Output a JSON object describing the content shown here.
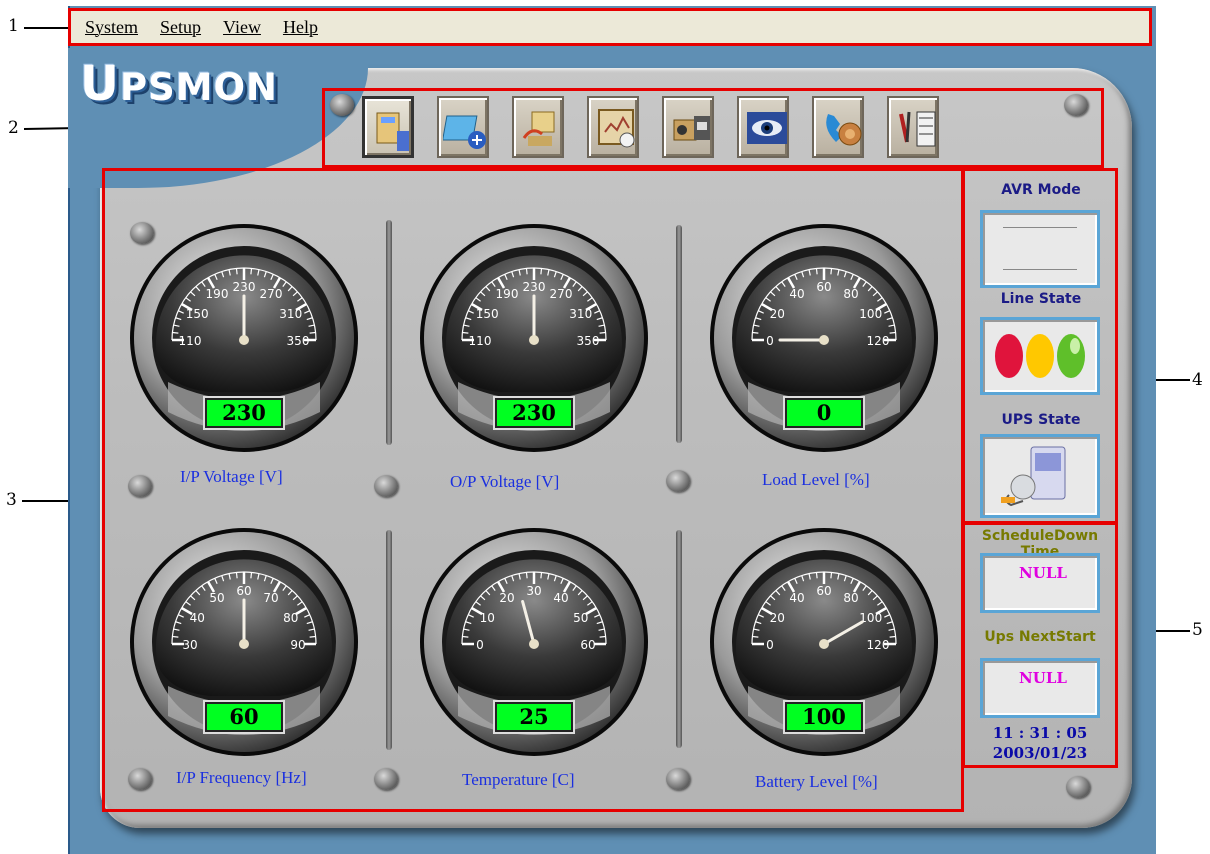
{
  "callouts": [
    "1",
    "2",
    "3",
    "4",
    "5"
  ],
  "menu": [
    "System",
    "Setup",
    "View",
    "Help"
  ],
  "logo": {
    "first": "U",
    "rest": "PSMON"
  },
  "toolbar": {
    "buttons": [
      {
        "name": "settings-tool-icon"
      },
      {
        "name": "add-device-icon"
      },
      {
        "name": "computer-transfer-icon"
      },
      {
        "name": "monitor-chart-icon"
      },
      {
        "name": "recorder-icon"
      },
      {
        "name": "eye-icon"
      },
      {
        "name": "phone-icon"
      },
      {
        "name": "tools-icon"
      }
    ]
  },
  "gauges": [
    {
      "label": "I/P Voltage [V]",
      "value": "230",
      "needle": 230,
      "min": 110,
      "max": 350,
      "ticks": [
        "110",
        "150",
        "190",
        "230",
        "270",
        "310",
        "350"
      ]
    },
    {
      "label": "O/P Voltage [V]",
      "value": "230",
      "needle": 230,
      "min": 110,
      "max": 350,
      "ticks": [
        "110",
        "150",
        "190",
        "230",
        "270",
        "310",
        "350"
      ]
    },
    {
      "label": "Load Level [%]",
      "value": "0",
      "needle": 0,
      "min": 0,
      "max": 120,
      "ticks": [
        "0",
        "20",
        "40",
        "60",
        "80",
        "100",
        "120"
      ]
    },
    {
      "label": "I/P Frequency [Hz]",
      "value": "60",
      "needle": 60,
      "min": 30,
      "max": 90,
      "ticks": [
        "30",
        "40",
        "50",
        "60",
        "70",
        "80",
        "90"
      ]
    },
    {
      "label": "Temperature [C]",
      "value": "25",
      "needle": 25,
      "min": 0,
      "max": 60,
      "ticks": [
        "0",
        "10",
        "20",
        "30",
        "40",
        "50",
        "60"
      ]
    },
    {
      "label": "Battery Level [%]",
      "value": "100",
      "needle": 100,
      "min": 0,
      "max": 120,
      "ticks": [
        "0",
        "20",
        "40",
        "60",
        "80",
        "100",
        "120"
      ]
    }
  ],
  "side": {
    "avr_title": "AVR Mode",
    "line_title": "Line State",
    "ups_title": "UPS State",
    "schedule_title": "ScheduleDown Time",
    "schedule_value": "NULL",
    "next_title": "Ups NextStart",
    "next_value": "NULL",
    "time": "11 : 31 : 05",
    "date": "2003/01/23"
  },
  "colors": {
    "needle_lights": [
      "#e0143c",
      "#ffc800",
      "#5fbf2a"
    ],
    "readout": "#00ff21",
    "label": "#1a2fe0"
  }
}
